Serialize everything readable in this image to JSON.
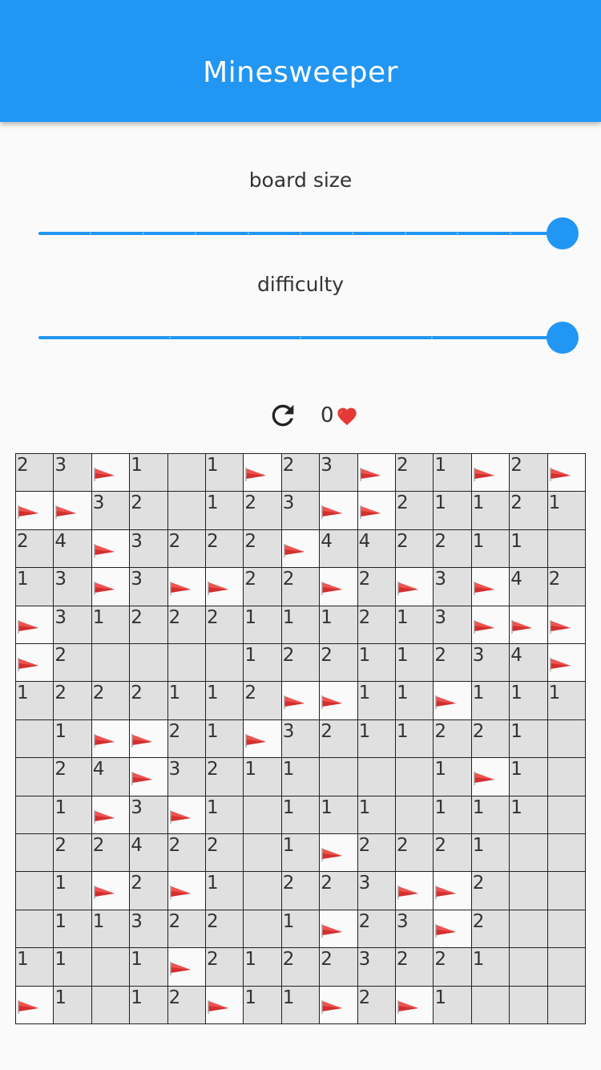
{
  "appbar": {
    "title": "Minesweeper"
  },
  "controls": {
    "board_size": {
      "label": "board size",
      "value_fraction": 1.0,
      "divisions": 10
    },
    "difficulty": {
      "label": "difficulty",
      "value_fraction": 1.0,
      "divisions": 4
    }
  },
  "status": {
    "reset_icon": "refresh-icon",
    "lives": "0",
    "heart_icon": "heart-icon"
  },
  "colors": {
    "primary": "#2196f3",
    "unrevealed": "#e0e0e0",
    "flag_bg": "#fafafa",
    "flag": "#d32f2f"
  },
  "board": {
    "size": 15,
    "rows": [
      [
        "2",
        "3",
        "F",
        "1",
        "",
        "1",
        "F",
        "2",
        "3",
        "F",
        "2",
        "1",
        "F",
        "2",
        "F"
      ],
      [
        "F",
        "F",
        "3",
        "2",
        "",
        "1",
        "2",
        "3",
        "F",
        "F",
        "2",
        "1",
        "1",
        "2",
        "1"
      ],
      [
        "2",
        "4",
        "F",
        "3",
        "2",
        "2",
        "2",
        "F",
        "4",
        "4",
        "2",
        "2",
        "1",
        "1",
        ""
      ],
      [
        "1",
        "3",
        "F",
        "3",
        "F",
        "F",
        "2",
        "2",
        "F",
        "2",
        "F",
        "3",
        "F",
        "4",
        "2"
      ],
      [
        "F",
        "3",
        "1",
        "2",
        "2",
        "2",
        "1",
        "1",
        "1",
        "2",
        "1",
        "3",
        "F",
        "F",
        "F"
      ],
      [
        "F",
        "2",
        "",
        "",
        "",
        "",
        "1",
        "2",
        "2",
        "1",
        "1",
        "2",
        "3",
        "4",
        "F"
      ],
      [
        "1",
        "2",
        "2",
        "2",
        "1",
        "1",
        "2",
        "F",
        "F",
        "1",
        "1",
        "F",
        "1",
        "1",
        "1"
      ],
      [
        "",
        "1",
        "F",
        "F",
        "2",
        "1",
        "F",
        "3",
        "2",
        "1",
        "1",
        "2",
        "2",
        "1",
        ""
      ],
      [
        "",
        "2",
        "4",
        "F",
        "3",
        "2",
        "1",
        "1",
        "",
        "",
        "",
        "1",
        "F",
        "1",
        ""
      ],
      [
        "",
        "1",
        "F",
        "3",
        "F",
        "1",
        "",
        "1",
        "1",
        "1",
        "",
        "1",
        "1",
        "1",
        ""
      ],
      [
        "",
        "2",
        "2",
        "4",
        "2",
        "2",
        "",
        "1",
        "F",
        "2",
        "2",
        "2",
        "1",
        "",
        ""
      ],
      [
        "",
        "1",
        "F",
        "2",
        "F",
        "1",
        "",
        "2",
        "2",
        "3",
        "F",
        "F",
        "2",
        "",
        ""
      ],
      [
        "",
        "1",
        "1",
        "3",
        "2",
        "2",
        "",
        "1",
        "F",
        "2",
        "3",
        "F",
        "2",
        "",
        ""
      ],
      [
        "1",
        "1",
        "",
        "1",
        "F",
        "2",
        "1",
        "2",
        "2",
        "3",
        "2",
        "2",
        "1",
        "",
        ""
      ],
      [
        "F",
        "1",
        "",
        "1",
        "2",
        "F",
        "1",
        "1",
        "F",
        "2",
        "F",
        "1",
        "",
        "",
        ""
      ]
    ]
  }
}
